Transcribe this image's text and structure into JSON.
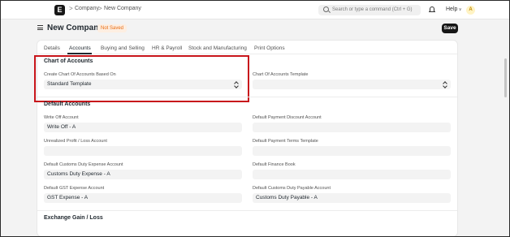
{
  "navbar": {
    "logo_letter": "E",
    "breadcrumbs": [
      "Company",
      "New Company"
    ],
    "breadcrumb_sep": ">",
    "search_placeholder": "Search or type a command (Ctrl + G)",
    "help_label": "Help",
    "help_chevron": "v",
    "avatar_initial": "A",
    "icons": [
      "logo-icon",
      "search-icon",
      "bell-icon",
      "chevron-down-icon"
    ]
  },
  "page": {
    "title": "New Company",
    "status_badge": "Not Saved",
    "save_label": "Save"
  },
  "tabs": [
    {
      "label": "Details",
      "active": false
    },
    {
      "label": "Accounts",
      "active": true
    },
    {
      "label": "Buying and Selling",
      "active": false
    },
    {
      "label": "HR & Payroll",
      "active": false
    },
    {
      "label": "Stock and Manufacturing",
      "active": false
    },
    {
      "label": "Print Options",
      "active": false
    }
  ],
  "chart_of_accounts": {
    "title": "Chart of Accounts",
    "based_on_label": "Create Chart Of Accounts Based On",
    "based_on_value": "Standard Template",
    "template_label": "Chart Of Accounts Template",
    "template_value": ""
  },
  "default_accounts": {
    "title": "Default Accounts",
    "fields": [
      {
        "label": "Write Off Account",
        "value": "Write Off - A"
      },
      {
        "label": "Default Payment Discount Account",
        "value": ""
      },
      {
        "label": "Unrealized Profit / Loss Account",
        "value": ""
      },
      {
        "label": "Default Payment Terms Template",
        "value": ""
      },
      {
        "label": "Default Customs Duty Expense Account",
        "value": "Customs Duty Expense - A"
      },
      {
        "label": "Default Finance Book",
        "value": ""
      },
      {
        "label": "Default GST Expense Account",
        "value": "GST Expense - A"
      },
      {
        "label": "Default Customs Duty Payable Account",
        "value": "Customs Duty Payable - A"
      }
    ]
  },
  "exchange_section": {
    "title": "Exchange Gain / Loss"
  },
  "colors": {
    "highlight": "#c8151b",
    "badge_text": "#e86c13",
    "badge_bg": "#fdeee1",
    "primary_button": "#171717"
  }
}
